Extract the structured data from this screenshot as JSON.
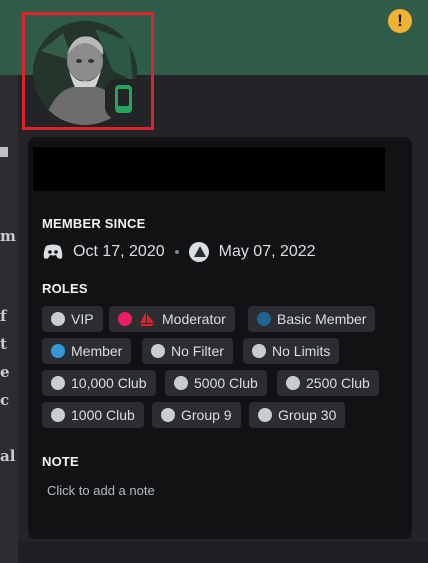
{
  "alert": {
    "icon": "warning-icon",
    "glyph": "!"
  },
  "avatar": {
    "icon": "user-avatar",
    "status": "mobile-online-icon",
    "status_color": "#23a55a",
    "highlight_color": "#e2222b"
  },
  "background_left_text": [
    "m",
    "f",
    "t",
    "e",
    "c",
    "al"
  ],
  "member_since": {
    "title": "MEMBER SINCE",
    "discord_date": "Oct 17, 2020",
    "server_date": "May 07, 2022",
    "discord_icon": "discord-logo-icon",
    "server_icon": "server-icon"
  },
  "roles": {
    "title": "ROLES",
    "items": [
      {
        "label": "VIP",
        "color": "#c9cdd2"
      },
      {
        "label": "Moderator",
        "color": "#e91e63",
        "emblem": "moderator-ship-icon"
      },
      {
        "label": "Basic Member",
        "color": "#206694"
      },
      {
        "label": "Member",
        "color": "#3498db"
      },
      {
        "label": "No Filter",
        "color": "#c9cdd2"
      },
      {
        "label": "No Limits",
        "color": "#c9cdd2"
      },
      {
        "label": "10,000 Club",
        "color": "#c9cdd2"
      },
      {
        "label": "5000 Club",
        "color": "#c9cdd2"
      },
      {
        "label": "2500 Club",
        "color": "#c9cdd2"
      },
      {
        "label": "1000 Club",
        "color": "#c9cdd2"
      },
      {
        "label": "Group 9",
        "color": "#c9cdd2"
      },
      {
        "label": "Group 30",
        "color": "#c9cdd2"
      }
    ]
  },
  "note": {
    "title": "NOTE",
    "placeholder": "Click to add a note"
  }
}
